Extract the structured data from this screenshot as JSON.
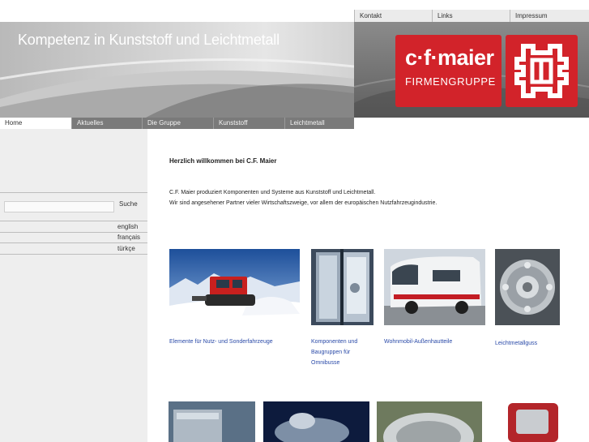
{
  "utility_nav": [
    {
      "label": "Kontakt"
    },
    {
      "label": "Links"
    },
    {
      "label": "Impressum"
    }
  ],
  "header": {
    "title": "Kompetenz in Kunststoff und Leichtmetall",
    "logo_name": "c·f·maier",
    "logo_sub": "FIRMENGRUPPE"
  },
  "main_nav": [
    {
      "label": "Home"
    },
    {
      "label": "Aktuelles"
    },
    {
      "label": "Die Gruppe"
    },
    {
      "label": "Kunststoff"
    },
    {
      "label": "Leichtmetall"
    }
  ],
  "sidebar": {
    "search_label": "Suche",
    "languages": [
      "english",
      "français",
      "türkçe"
    ]
  },
  "main": {
    "welcome": "Herzlich willkommen bei C.F. Maier",
    "intro_line1": "C.F. Maier produziert Komponenten und Systeme aus Kunststoff und Leichtmetall.",
    "intro_line2": "Wir sind angesehener Partner vieler Wirtschaftszweige, vor allem der europäischen Nutzfahrzeugindustrie.",
    "products": [
      {
        "caption": "Elemente für Nutz- und Sonderfahrzeuge"
      },
      {
        "caption_lines": [
          "Komponenten und",
          "Baugruppen für",
          "Omnibusse"
        ]
      },
      {
        "caption": "Wohnmobil-Außenhautteile"
      },
      {
        "caption": "Leichtmetallguss"
      }
    ]
  },
  "colors": {
    "brand_red": "#d2232a",
    "nav_gray": "#7a7a7a",
    "link_blue": "#2a4aa8"
  }
}
